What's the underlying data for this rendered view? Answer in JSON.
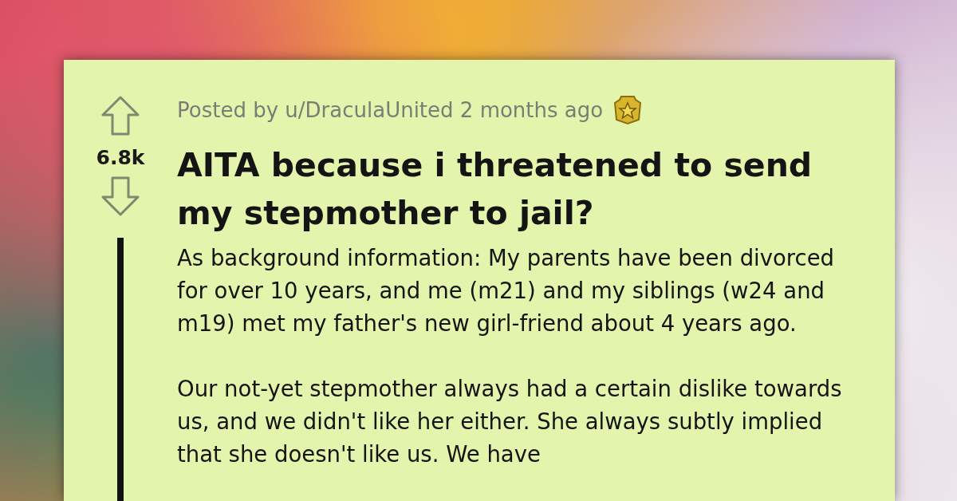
{
  "post": {
    "score": "6.8k",
    "meta": "Posted by u/DraculaUnited 2 months ago",
    "title": "AITA because i threatened to send my stepmother to jail?",
    "body": [
      "As background information: My parents have been divorced for over 10 years, and me (m21) and my siblings (w24 and m19) met my father's new girl-friend about 4 years ago.",
      "Our not-yet stepmother always had a certain dislike towards us, and we didn't like her either. She always subtly implied that she doesn't like us. We have"
    ]
  }
}
